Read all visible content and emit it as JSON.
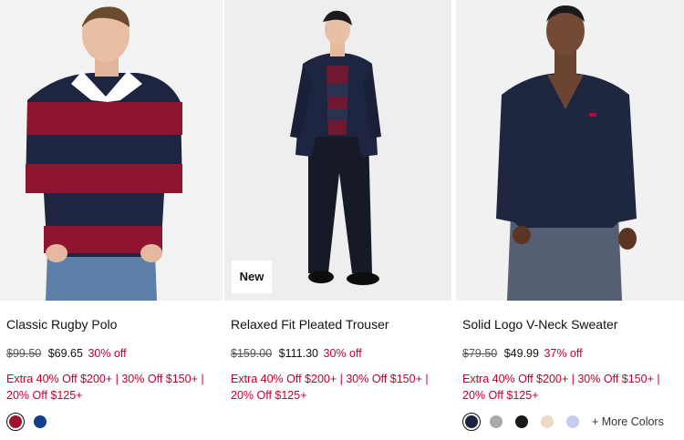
{
  "products": [
    {
      "title": "Classic Rugby Polo",
      "badge": "",
      "original_price": "$99.50",
      "sale_price": "$69.65",
      "discount": "30% off",
      "promo": "Extra 40% Off $200+ | 30% Off $150+ | 20% Off $125+",
      "swatches": [
        "#a0112b",
        "#153f8a"
      ],
      "more_colors": ""
    },
    {
      "title": "Relaxed Fit Pleated Trouser",
      "badge": "New",
      "original_price": "$159.00",
      "sale_price": "$111.30",
      "discount": "30% off",
      "promo": "Extra 40% Off $200+ | 30% Off $150+ | 20% Off $125+",
      "swatches": [],
      "more_colors": ""
    },
    {
      "title": "Solid Logo V-Neck Sweater",
      "badge": "",
      "original_price": "$79.50",
      "sale_price": "$49.99",
      "discount": "37% off",
      "promo": "Extra 40% Off $200+ | 30% Off $150+ | 20% Off $125+",
      "swatches": [
        "#1b2440",
        "#a9a9a9",
        "#1a1a1a",
        "#e8dcc9",
        "#c5cdf0"
      ],
      "more_colors": "+ More Colors"
    }
  ],
  "colors": {
    "sale_red": "#c4002f",
    "navy": "#1b2440",
    "burgundy": "#8e1430"
  }
}
